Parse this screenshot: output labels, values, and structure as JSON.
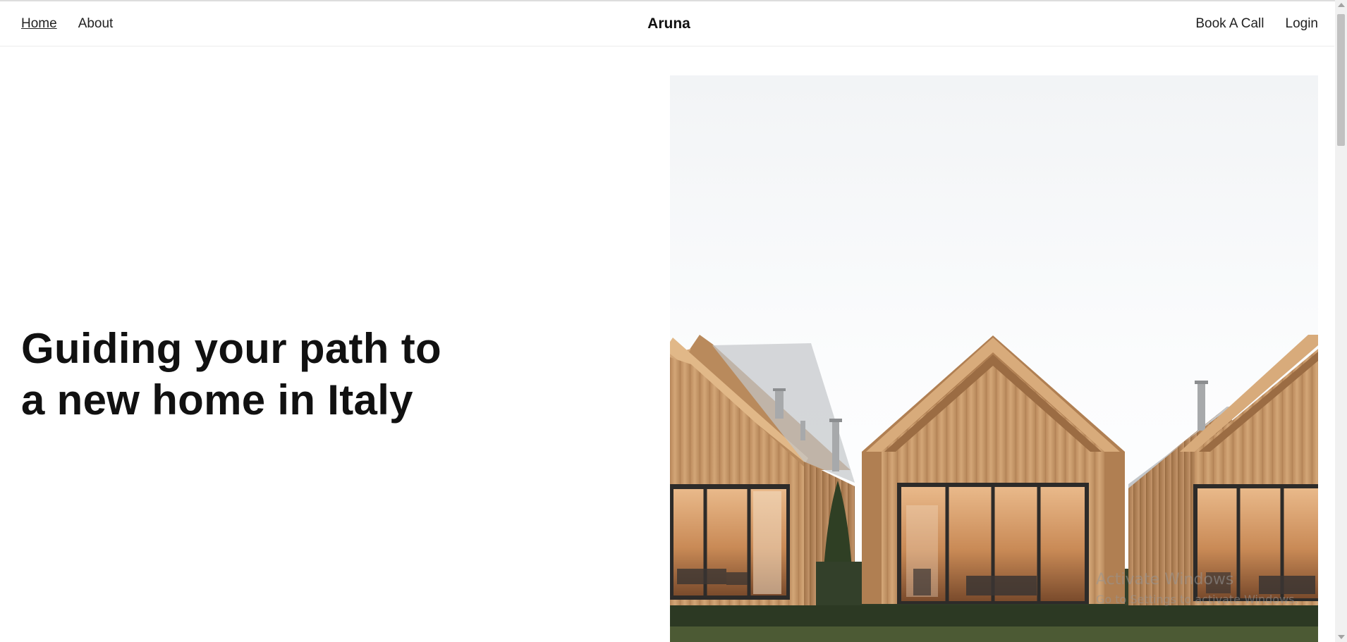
{
  "nav": {
    "left": [
      {
        "label": "Home",
        "active": true
      },
      {
        "label": "About",
        "active": false
      }
    ],
    "brand": "Aruna",
    "right": [
      {
        "label": "Book A Call"
      },
      {
        "label": "Login"
      }
    ]
  },
  "hero": {
    "title": "Guiding your path to a new home in Italy",
    "image_icon": "modern-wooden-houses-photo"
  },
  "watermark": {
    "title": "Activate Windows",
    "subtitle": "Go to Settings to activate Windows."
  },
  "colors": {
    "text": "#111111",
    "nav_text": "#222222",
    "divider": "#ececec",
    "wood": "#c99a66",
    "hedge": "#2f3b27"
  }
}
